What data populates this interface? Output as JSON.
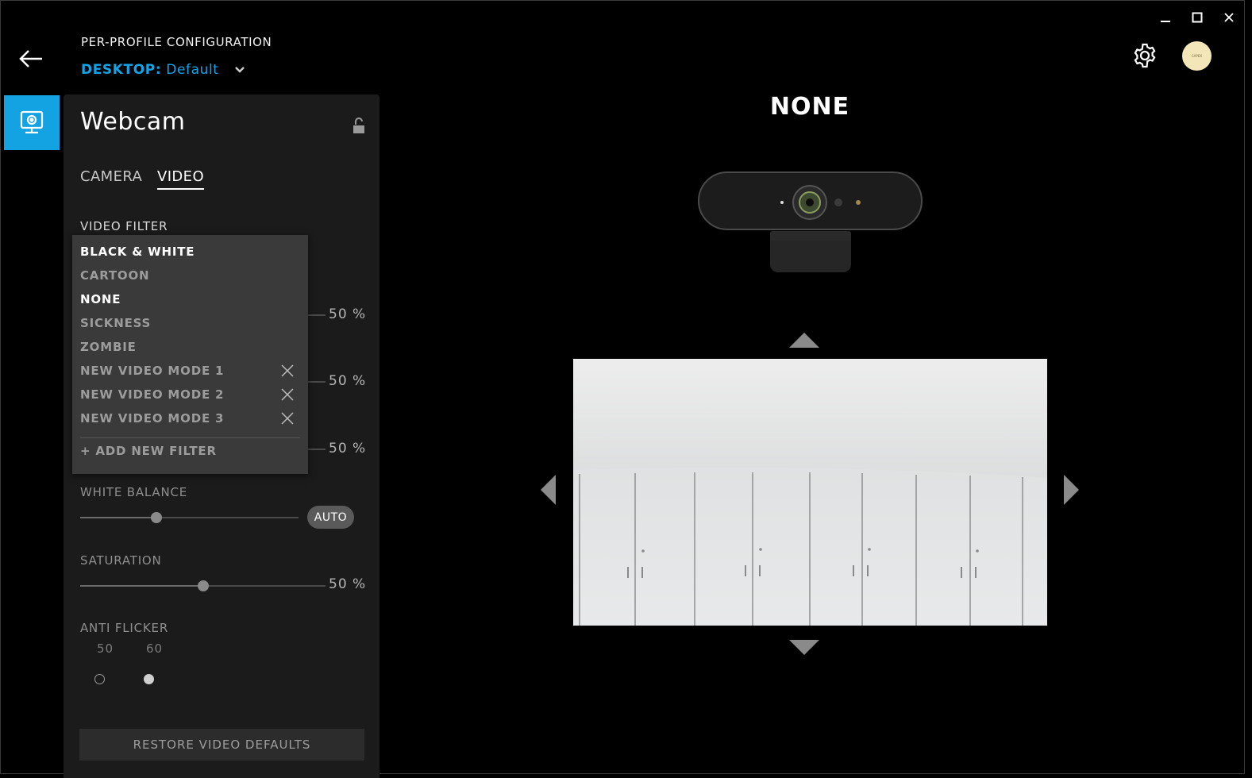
{
  "window": {
    "minimize_icon": "minimize-icon",
    "maximize_icon": "maximize-icon",
    "close_icon": "close-icon"
  },
  "header": {
    "back_icon": "arrow-left-icon",
    "section_label": "PER-PROFILE CONFIGURATION",
    "profile_key": "DESKTOP:",
    "profile_value": "Default",
    "profile_chevron": "chevron-down-icon",
    "accent_color": "#12a4e8"
  },
  "device": {
    "tab_icon": "webcam-icon",
    "tab_color": "#13a3e3",
    "title": "Webcam",
    "lock_icon": "unlock-icon"
  },
  "tabs": [
    {
      "label": "CAMERA",
      "active": false
    },
    {
      "label": "VIDEO",
      "active": true
    }
  ],
  "video": {
    "filter_label": "VIDEO FILTER",
    "hidden_sliders": [
      {
        "value_text": "50 %"
      },
      {
        "value_text": "50 %"
      },
      {
        "value_text": "50 %"
      }
    ],
    "white_balance": {
      "label": "WHITE BALANCE",
      "value": 0.35,
      "auto_label": "AUTO"
    },
    "saturation": {
      "label": "SATURATION",
      "value": 0.5,
      "value_text": "50 %"
    },
    "anti_flicker": {
      "label": "ANTI FLICKER",
      "options": [
        "50",
        "60"
      ],
      "selected": "60"
    },
    "restore_label": "RESTORE VIDEO DEFAULTS"
  },
  "filter_dropdown": {
    "items": [
      {
        "label": "BLACK & WHITE",
        "removable": false
      },
      {
        "label": "CARTOON",
        "removable": false
      },
      {
        "label": "NONE",
        "removable": false
      },
      {
        "label": "SICKNESS",
        "removable": false
      },
      {
        "label": "ZOMBIE",
        "removable": false
      },
      {
        "label": "NEW VIDEO MODE 1",
        "removable": true
      },
      {
        "label": "NEW VIDEO MODE 2",
        "removable": true
      },
      {
        "label": "NEW VIDEO MODE 3",
        "removable": true
      }
    ],
    "add_label": "+ ADD NEW FILTER"
  },
  "preview": {
    "selected_filter": "NONE",
    "settings_icon": "gear-icon",
    "avatar_text": "CAPEX"
  }
}
